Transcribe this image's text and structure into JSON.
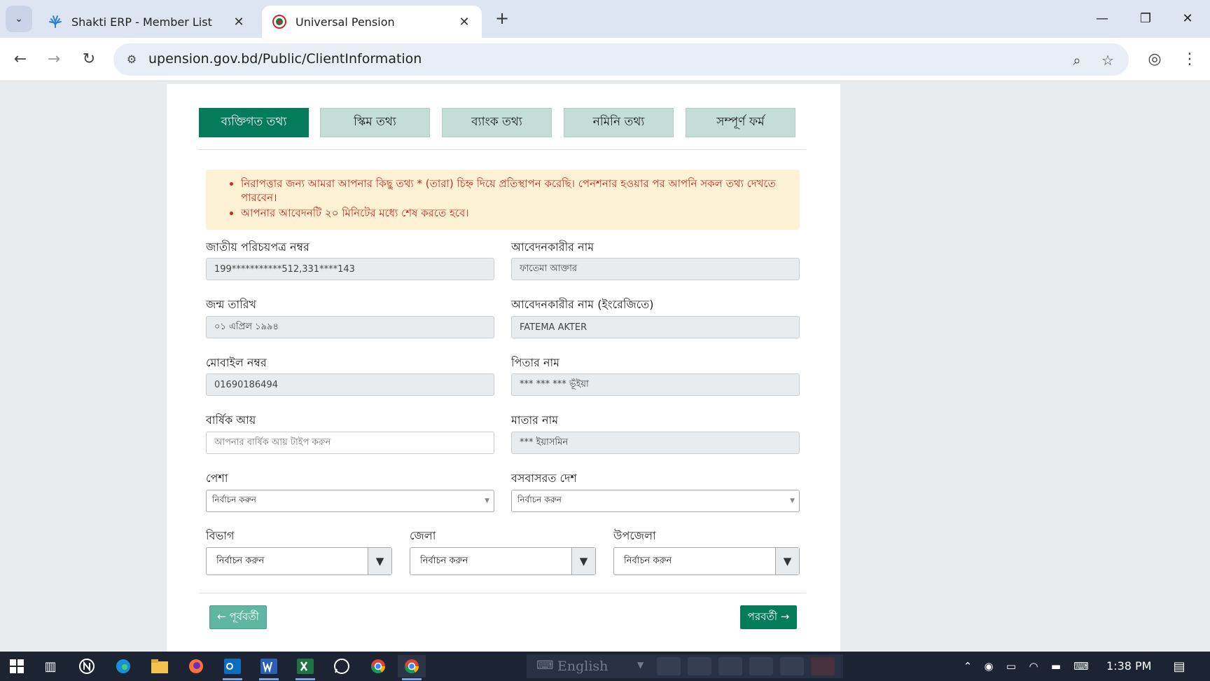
{
  "browser": {
    "tabs": [
      {
        "title": "Shakti ERP - Member List",
        "active": false
      },
      {
        "title": "Universal Pension",
        "active": true
      }
    ],
    "url": "upension.gov.bd/Public/ClientInformation"
  },
  "steps": [
    "ব্যক্তিগত তথ্য",
    "স্কিম তথ্য",
    "ব্যাংক তথ্য",
    "নমিনি তথ্য",
    "সম্পূর্ণ ফর্ম"
  ],
  "notice": [
    "নিরাপত্তার জন্য আমরা আপনার কিছু তথ্য * (তারা) চিহ্ন দিয়ে প্রতিস্থাপন করেছি। পেনশনার হওয়ার পর আপনি সকল তথ্য দেখতে পারবেন।",
    "আপনার আবেদনটি ২০ মিনিটের মধ্যে শেষ করতে হবে।"
  ],
  "form": {
    "nid_label": "জাতীয় পরিচয়পত্র নম্বর",
    "nid_value": "199***********512,331****143",
    "name_label": "আবেদনকারীর নাম",
    "name_value": "ফাতেমা আক্তার",
    "dob_label": "জন্ম তারিখ",
    "dob_value": "০১ এপ্রিল ১৯৯৪",
    "name_en_label": "আবেদনকারীর নাম (ইংরেজিতে)",
    "name_en_value": "FATEMA AKTER",
    "mobile_label": "মোবাইল নম্বর",
    "mobile_value": "01690186494",
    "father_label": "পিতার নাম",
    "father_value": "*** *** *** ভূঁইয়া",
    "income_label": "বার্ষিক আয়",
    "income_placeholder": "আপনার বার্ষিক আয় টাইপ করুন",
    "mother_label": "মাতার নাম",
    "mother_value": "*** ইয়াসমিন",
    "occupation_label": "পেশা",
    "occupation_value": "নির্বাচন করুন",
    "country_label": "বসবাসরত দেশ",
    "country_value": "নির্বাচন করুন",
    "division_label": "বিভাগ",
    "division_value": "নির্বাচন করুন",
    "district_label": "জেলা",
    "district_value": "নির্বাচন করুন",
    "upazila_label": "উপজেলা",
    "upazila_value": "নির্বাচন করুন"
  },
  "buttons": {
    "prev": "← পূর্ববর্তী",
    "next": "পরবর্তী →"
  },
  "taskbar": {
    "language": "English",
    "time": "1:38 PM"
  }
}
